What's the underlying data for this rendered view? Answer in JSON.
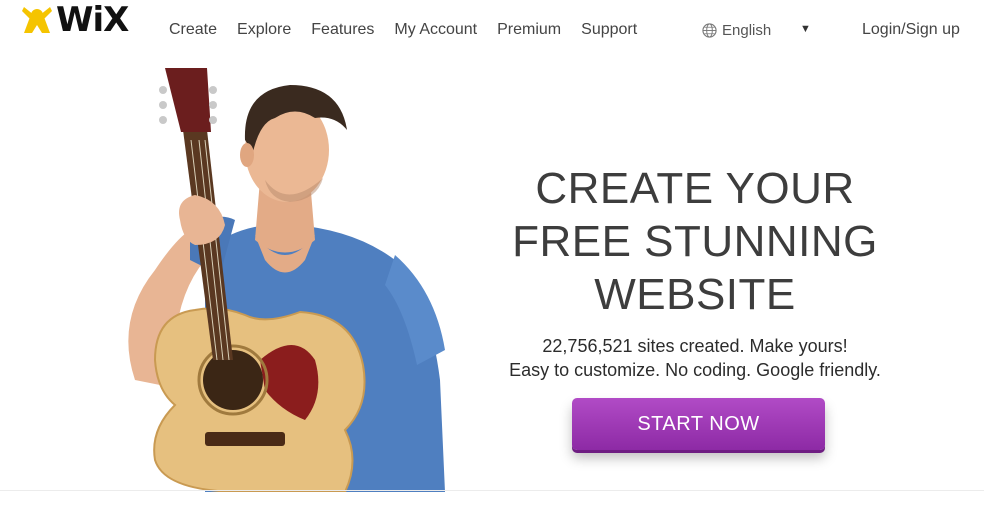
{
  "brand": {
    "name": "WiX"
  },
  "nav": {
    "items": [
      {
        "label": "Create"
      },
      {
        "label": "Explore"
      },
      {
        "label": "Features"
      },
      {
        "label": "My Account"
      },
      {
        "label": "Premium"
      },
      {
        "label": "Support"
      }
    ]
  },
  "language": {
    "label": "English",
    "icon": "globe-icon",
    "caret_icon": "caret-down-icon"
  },
  "account": {
    "login_label": "Login/Sign up"
  },
  "hero": {
    "headline_line1": "CREATE YOUR",
    "headline_line2": "FREE STUNNING",
    "headline_line3": "WEBSITE",
    "subline1": "22,756,521 sites created. Make yours!",
    "subline2": "Easy to customize. No coding. Google friendly.",
    "cta_label": "START NOW"
  },
  "colors": {
    "cta": "#9b34b3",
    "text": "#3d3d3d",
    "logo_yellow": "#f5c400"
  }
}
